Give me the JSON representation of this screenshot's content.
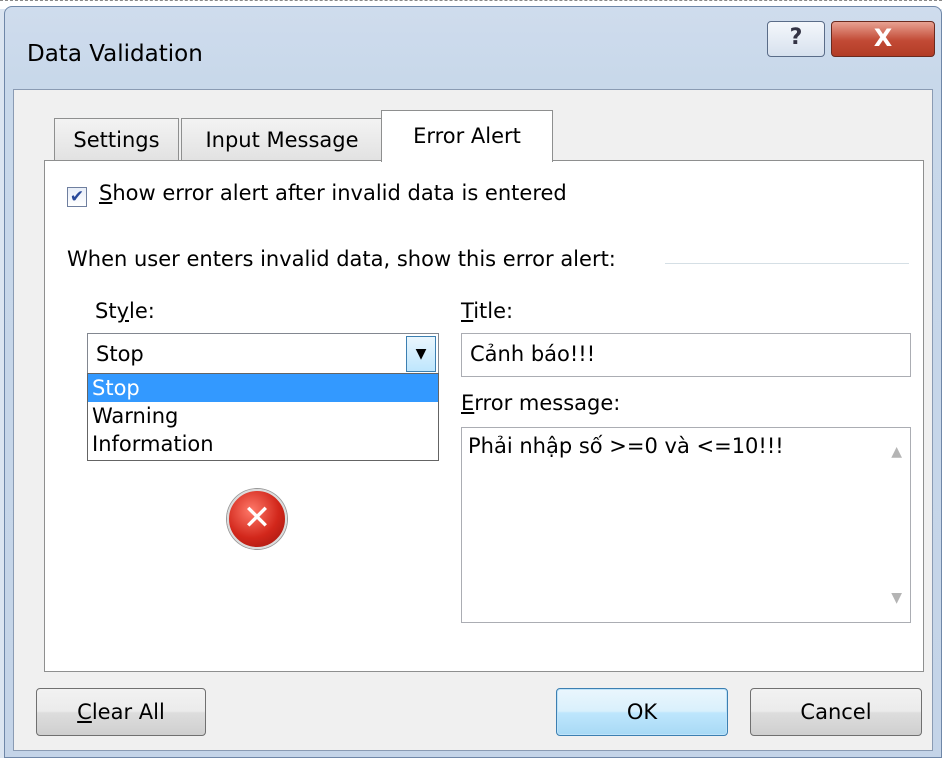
{
  "window": {
    "title": "Data Validation",
    "help_label": "?",
    "close_label": "X"
  },
  "tabs": [
    {
      "label": "Settings"
    },
    {
      "label": "Input Message"
    },
    {
      "label": "Error Alert",
      "active": true
    }
  ],
  "error_alert": {
    "show_alert_checked": true,
    "show_alert_label_accel": "S",
    "show_alert_label_rest": "how error alert after invalid data is entered",
    "group_label": "When user enters invalid data, show this error alert:",
    "style_label_pre": "St",
    "style_label_accel": "y",
    "style_label_post": "le:",
    "style_value": "Stop",
    "style_options": [
      "Stop",
      "Warning",
      "Information"
    ],
    "title_label_accel": "T",
    "title_label_rest": "itle:",
    "title_value": "Cảnh báo!!!",
    "error_message_label_accel": "E",
    "error_message_label_rest": "rror message:",
    "error_message_value": "Phải nhập số >=0 và <=10!!!",
    "icon": "stop-error-icon"
  },
  "buttons": {
    "clear_all_accel": "C",
    "clear_all_rest": "lear All",
    "ok": "OK",
    "cancel": "Cancel"
  }
}
